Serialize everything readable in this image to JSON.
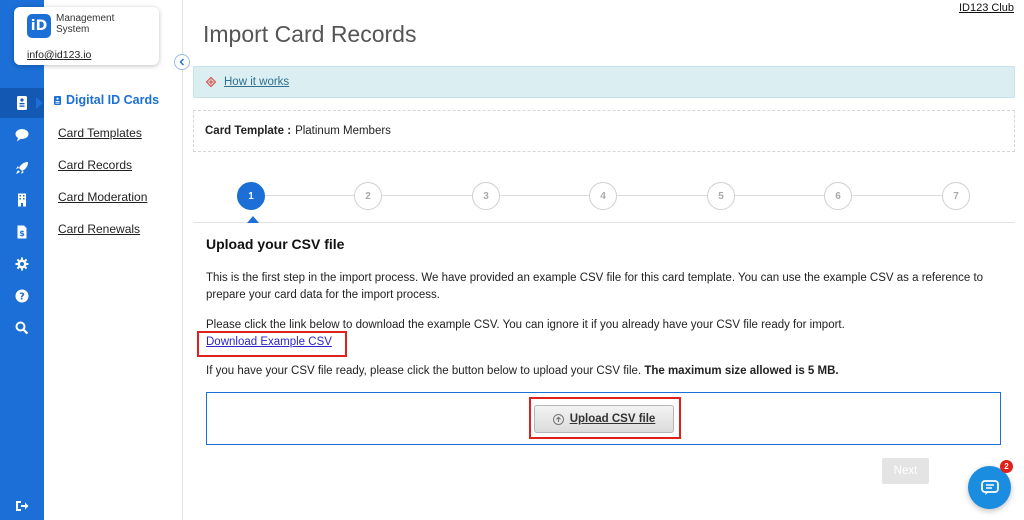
{
  "brand": {
    "logo_text": "iD",
    "name": "Management System",
    "email": "info@id123.io"
  },
  "rail_icons": [
    "id-card-icon",
    "chat-icon",
    "rocket-icon",
    "building-icon",
    "dollar-document-icon",
    "gear-icon",
    "help-icon",
    "search-icon",
    "logout-icon"
  ],
  "sidebar": {
    "title": "Digital ID Cards",
    "items": [
      {
        "label": "Card Templates"
      },
      {
        "label": "Card Records"
      },
      {
        "label": "Card Moderation"
      },
      {
        "label": "Card Renewals"
      }
    ]
  },
  "header": {
    "club_name": "ID123 Club",
    "title": "Import Card Records"
  },
  "info_bar": {
    "link_label": "How it works"
  },
  "template": {
    "label": "Card Template :",
    "value": "Platinum Members"
  },
  "stepper": {
    "steps": [
      "1",
      "2",
      "3",
      "4",
      "5",
      "6",
      "7"
    ],
    "active_step": 1
  },
  "content": {
    "section_title": "Upload your CSV file",
    "intro": "This is the first step in the import process. We have provided an example CSV file for this card template. You can use the example CSV as a reference to prepare your card data for the import process.",
    "download_hint": "Please click the link below to download the example CSV. You can ignore it if you already have your CSV file ready for import.",
    "download_link": "Download Example CSV",
    "upload_hint": "If you have your CSV file ready, please click the button below to upload your CSV file.",
    "max_size": "The maximum size allowed is 5 MB.",
    "upload_button": "Upload CSV file",
    "next_button": "Next"
  },
  "chat": {
    "badge_count": "2"
  },
  "colors": {
    "accent": "#1b6fd6",
    "highlight": "#e0201b",
    "info_bg": "#dbeff3"
  }
}
